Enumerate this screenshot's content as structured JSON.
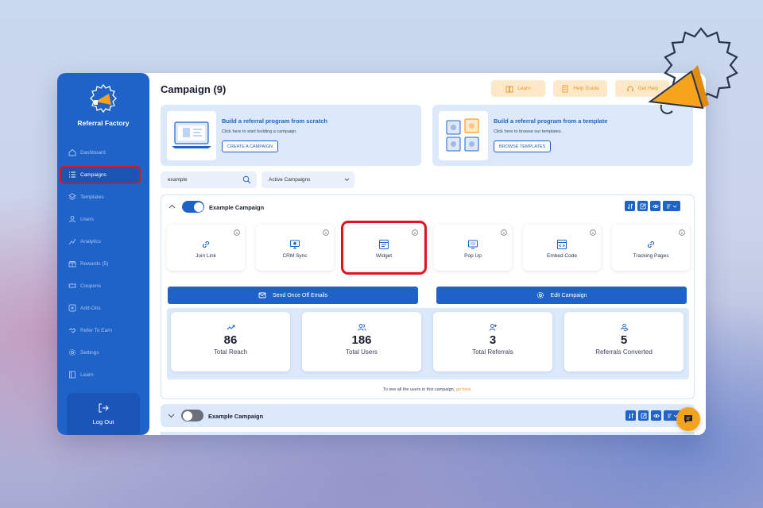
{
  "sidebar": {
    "brand": "Referral Factory",
    "items": [
      {
        "label": "Dashboard",
        "icon": "home-icon"
      },
      {
        "label": "Campaigns",
        "icon": "list-icon",
        "active": true
      },
      {
        "label": "Templates",
        "icon": "layers-icon"
      },
      {
        "label": "Users",
        "icon": "user-icon"
      },
      {
        "label": "Analytics",
        "icon": "chart-icon"
      },
      {
        "label": "Rewards (5)",
        "icon": "reward-icon"
      },
      {
        "label": "Coupons",
        "icon": "coupon-icon"
      },
      {
        "label": "Add-Ons",
        "icon": "addon-icon"
      },
      {
        "label": "Refer To Earn",
        "icon": "handshake-icon"
      },
      {
        "label": "Settings",
        "icon": "gear-icon"
      },
      {
        "label": "Learn",
        "icon": "book-icon"
      }
    ],
    "logout": "Log Out"
  },
  "header": {
    "title": "Campaign (9)",
    "learn": "Learn",
    "help_guide": "Help Guide",
    "get_help": "Get Help"
  },
  "banners": {
    "scratch": {
      "title": "Build a referral program from scratch",
      "subtitle": "Click here to start building a campaign.",
      "button": "CREATE A CAMPAIGN"
    },
    "template": {
      "title": "Build a referral program from a template",
      "subtitle": "Click here to browse our templates.",
      "button": "BROWSE TEMPLATES"
    }
  },
  "filters": {
    "search_value": "example",
    "status_select": "Active Campaigns"
  },
  "campaign": {
    "name": "Example Campaign",
    "enabled": true,
    "tiles": [
      "Join Link",
      "CRM Sync",
      "Widget",
      "Pop Up",
      "Embed Code",
      "Tracking Pages"
    ],
    "send_emails": "Send Once Off Emails",
    "edit": "Edit Campaign",
    "stats": [
      {
        "value": "86",
        "label": "Total Reach"
      },
      {
        "value": "186",
        "label": "Total Users"
      },
      {
        "value": "3",
        "label": "Total Referrals"
      },
      {
        "value": "5",
        "label": "Referrals Converted"
      }
    ],
    "footnote_text": "To see all the users in this campaign, ",
    "footnote_link": "go here."
  },
  "campaign2": {
    "name": "Example Campaign",
    "enabled": false
  },
  "colors": {
    "primary": "#1f63c8",
    "accent": "#f4a321",
    "highlight": "#e0141e"
  }
}
